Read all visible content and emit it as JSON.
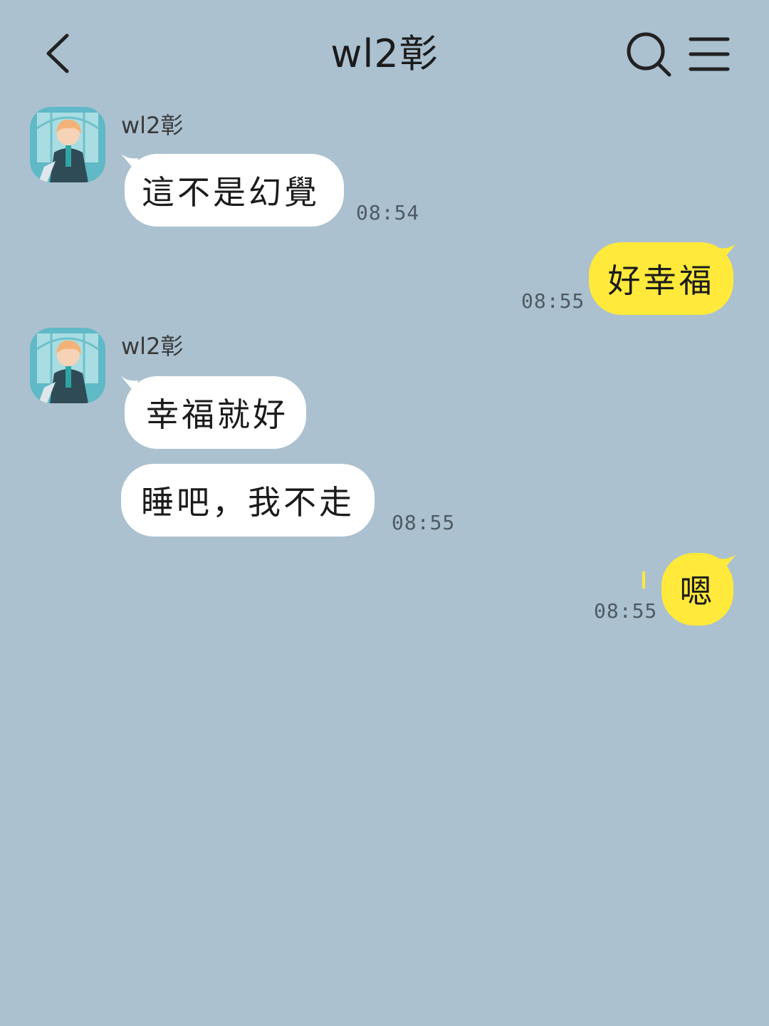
{
  "header": {
    "title": "wl2彰",
    "back_icon": "chevron-left-icon",
    "search_icon": "search-icon",
    "menu_icon": "menu-icon"
  },
  "colors": {
    "background": "#abc1d0",
    "incoming_bubble": "#ffffff",
    "outgoing_bubble": "#ffe93b"
  },
  "messages": [
    {
      "direction": "incoming",
      "sender": "wl2彰",
      "text": "這不是幻覺",
      "time": "08:54"
    },
    {
      "direction": "outgoing",
      "text": "好幸福",
      "time": "08:55"
    },
    {
      "direction": "incoming",
      "sender": "wl2彰",
      "text": "幸福就好",
      "time": ""
    },
    {
      "direction": "incoming",
      "text": "睡吧，我不走",
      "time": "08:55"
    },
    {
      "direction": "outgoing",
      "text": "嗯",
      "time": "08:55"
    }
  ]
}
